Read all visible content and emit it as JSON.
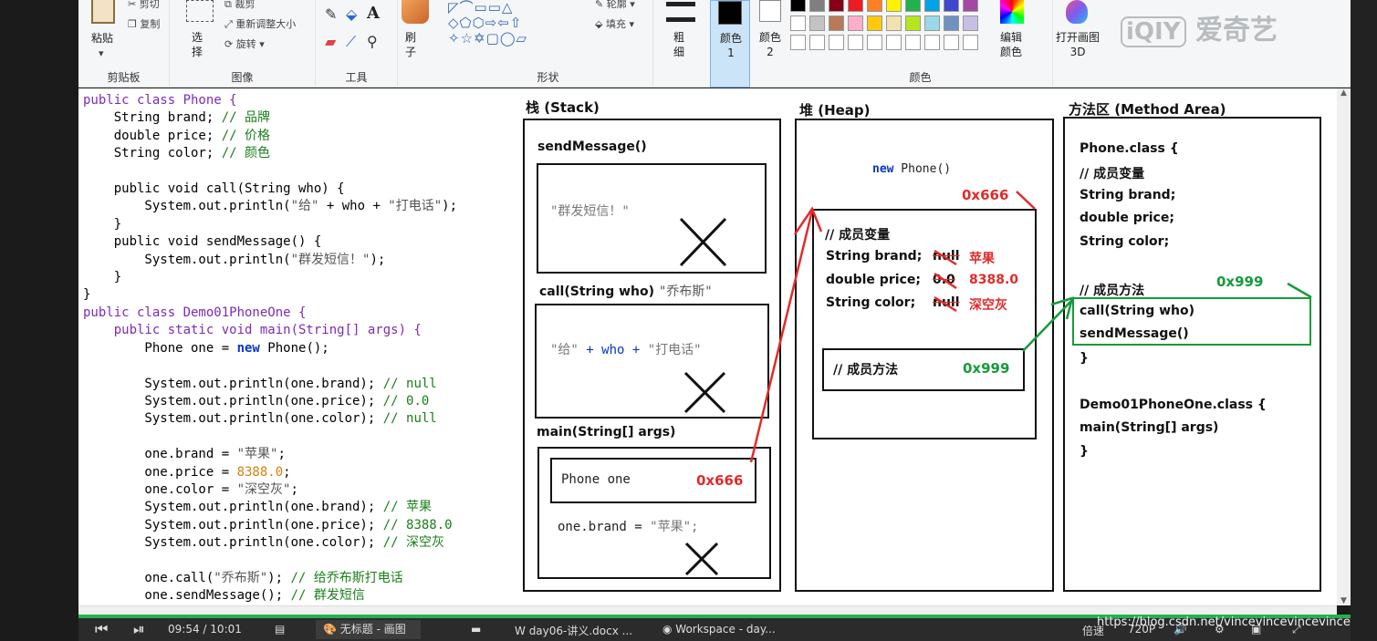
{
  "ribbon": {
    "clipboard": {
      "paste": "粘贴",
      "cut": "剪切",
      "copy": "复制",
      "group": "剪贴板"
    },
    "image": {
      "select": "选择",
      "crop": "裁剪",
      "resize": "重新调整大小",
      "rotate": "旋转",
      "group": "图像"
    },
    "tools": {
      "group": "工具"
    },
    "brush": {
      "label": "刷子"
    },
    "shapes": {
      "group": "形状",
      "outline": "轮廓",
      "fill": "填充"
    },
    "size": {
      "label": "粗细"
    },
    "color1": {
      "label": "颜色 1"
    },
    "color2": {
      "label": "颜色 2"
    },
    "colors": {
      "group": "颜色",
      "edit": "编辑颜色"
    },
    "paint3d": {
      "label": "打开画图 3D"
    },
    "logo": "爱奇艺",
    "palette": [
      "#000000",
      "#7f7f7f",
      "#880015",
      "#ed1c24",
      "#ff7f27",
      "#fff200",
      "#22b14c",
      "#00a2e8",
      "#3f48cc",
      "#a349a4",
      "#ffffff",
      "#c3c3c3",
      "#b97a57",
      "#ffaec9",
      "#ffc90e",
      "#efe4b0",
      "#b5e61d",
      "#99d9ea",
      "#7092be",
      "#c8bfe7"
    ]
  },
  "code": {
    "l1": "public class Phone {",
    "l2a": "    String brand; ",
    "l2b": "// 品牌",
    "l3a": "    double price; ",
    "l3b": "// 价格",
    "l4a": "    String color; ",
    "l4b": "// 颜色",
    "l6": "    public void call(String who) {",
    "l7a": "        System.out.println(",
    "l7b": "\"给\"",
    "l7c": " + who + ",
    "l7d": "\"打电话\"",
    "l7e": ");",
    "l8": "    }",
    "l9": "    public void sendMessage() {",
    "l10a": "        System.out.println(",
    "l10b": "\"群发短信！\"",
    "l10c": ");",
    "l11": "    }",
    "l12": "}",
    "l13": "public class Demo01PhoneOne {",
    "l14": "    public static void main(String[] args) {",
    "l15a": "        Phone one = ",
    "l15b": "new",
    "l15c": " Phone();",
    "l17a": "        System.out.println(one.brand); ",
    "l17b": "// null",
    "l18a": "        System.out.println(one.price); ",
    "l18b": "// 0.0",
    "l19a": "        System.out.println(one.color); ",
    "l19b": "// null",
    "l21a": "        one.brand = ",
    "l21b": "\"苹果\"",
    "l21c": ";",
    "l22a": "        one.price = ",
    "l22b": "8388.0",
    "l22c": ";",
    "l23a": "        one.color = ",
    "l23b": "\"深空灰\"",
    "l23c": ";",
    "l24a": "        System.out.println(one.brand); ",
    "l24b": "// 苹果",
    "l25a": "        System.out.println(one.price); ",
    "l25b": "// 8388.0",
    "l26a": "        System.out.println(one.color); ",
    "l26b": "// 深空灰",
    "l28a": "        one.call(",
    "l28b": "\"乔布斯\"",
    "l28c": "); ",
    "l28d": "// 给乔布斯打电话",
    "l29a": "        one.sendMessage(); ",
    "l29b": "// 群发短信"
  },
  "stack": {
    "title": "栈 (Stack)",
    "send": "sendMessage()",
    "send_text": "\"群发短信！\"",
    "call": "call(String who)",
    "call_arg": "\"乔布斯\"",
    "call_text_a": "\"给\"",
    "call_text_b": " + who + ",
    "call_text_c": "\"打电话\"",
    "main": "main(String[] args)",
    "phone_one": "Phone one",
    "addr": "0x666",
    "brand_a": "one.brand = ",
    "brand_b": "\"苹果\";"
  },
  "heap": {
    "title": "堆 (Heap)",
    "new_kw": "new",
    "new_rest": " Phone()",
    "addr": "0x666",
    "vars": "// 成员变量",
    "brand": "String brand;",
    "brand_old": "null",
    "brand_new": "苹果",
    "price": "double price;",
    "price_old": "0.0",
    "price_new": "8388.0",
    "color": "String color;",
    "color_old": "null",
    "color_new": "深空灰",
    "methods": "// 成员方法",
    "methods_addr": "0x999"
  },
  "method": {
    "title": "方法区 (Method Area)",
    "class": "Phone.class {",
    "vars": "// 成员变量",
    "v1": "String brand;",
    "v2": "double price;",
    "v3": "String color;",
    "methods": "// 成员方法",
    "addr": "0x999",
    "m1": "call(String who)",
    "m2": "sendMessage()",
    "close1": "}",
    "class2": "Demo01PhoneOne.class {",
    "m3": "main(String[] args)",
    "close2": "}"
  },
  "taskbar": {
    "time_cur": "09:54",
    "sep": "/",
    "time_total": "10:01",
    "paint": "无标题 - 画图",
    "docx": "day06-讲义.docx ...",
    "workspace": "Workspace - day...",
    "speed": "倍速",
    "quality": "720P"
  },
  "watermark": "https://blog.csdn.net/vincevincevincevince"
}
